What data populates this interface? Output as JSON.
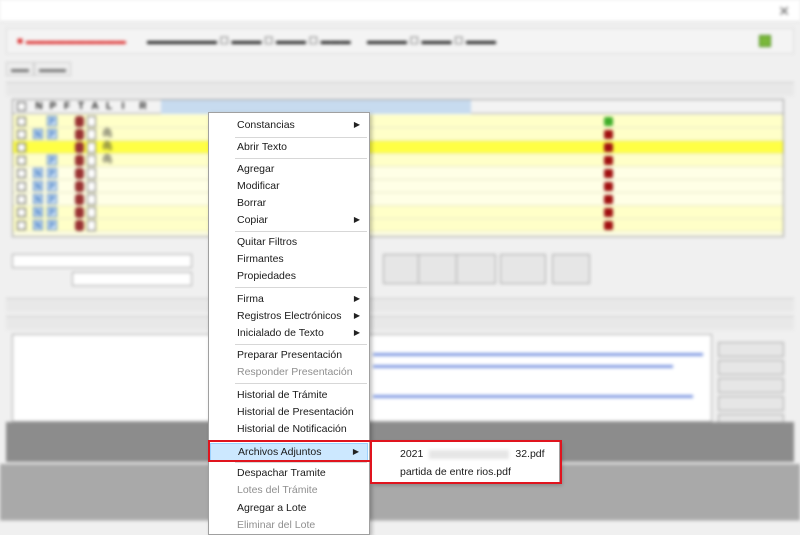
{
  "grid": {
    "flag_columns": [
      "N",
      "P",
      "F",
      "T",
      "A",
      "L",
      "I",
      "R"
    ]
  },
  "context_menu": {
    "items": [
      {
        "label": "Constancias",
        "submenu": true,
        "disabled": false
      },
      {
        "label": "Abrir Texto",
        "submenu": false,
        "disabled": false
      },
      {
        "label": "Agregar",
        "submenu": false,
        "disabled": false
      },
      {
        "label": "Modificar",
        "submenu": false,
        "disabled": false
      },
      {
        "label": "Borrar",
        "submenu": false,
        "disabled": false
      },
      {
        "label": "Copiar",
        "submenu": true,
        "disabled": false
      },
      {
        "label": "Quitar Filtros",
        "submenu": false,
        "disabled": false
      },
      {
        "label": "Firmantes",
        "submenu": false,
        "disabled": false
      },
      {
        "label": "Propiedades",
        "submenu": false,
        "disabled": false
      },
      {
        "label": "Firma",
        "submenu": true,
        "disabled": false
      },
      {
        "label": "Registros Electrónicos",
        "submenu": true,
        "disabled": false
      },
      {
        "label": "Inicialado de Texto",
        "submenu": true,
        "disabled": false
      },
      {
        "label": "Preparar Presentación",
        "submenu": false,
        "disabled": false
      },
      {
        "label": "Responder Presentación",
        "submenu": false,
        "disabled": true
      },
      {
        "label": "Historial de Trámite",
        "submenu": false,
        "disabled": false
      },
      {
        "label": "Historial de Presentación",
        "submenu": false,
        "disabled": false
      },
      {
        "label": "Historial de Notificación",
        "submenu": false,
        "disabled": false
      },
      {
        "label": "Archivos Adjuntos",
        "submenu": true,
        "disabled": false,
        "selected": true
      },
      {
        "label": "Despachar Tramite",
        "submenu": false,
        "disabled": false
      },
      {
        "label": "Lotes del Trámite",
        "submenu": false,
        "disabled": true
      },
      {
        "label": "Agregar a Lote",
        "submenu": false,
        "disabled": false
      },
      {
        "label": "Eliminar del Lote",
        "submenu": false,
        "disabled": true
      }
    ]
  },
  "attachments_submenu": {
    "items": [
      {
        "prefix": "2021",
        "suffix": "32.pdf"
      },
      {
        "label": "partida de entre rios.pdf"
      }
    ]
  },
  "icons": {
    "submenu_arrow": "triangle-right-icon",
    "attachment": "paperclip-icon"
  },
  "colors": {
    "highlight_row": "#ffff44",
    "grid_background": "#ffffe6",
    "menu_selected": "#cce8ff",
    "annotation_red": "#e0141e"
  }
}
